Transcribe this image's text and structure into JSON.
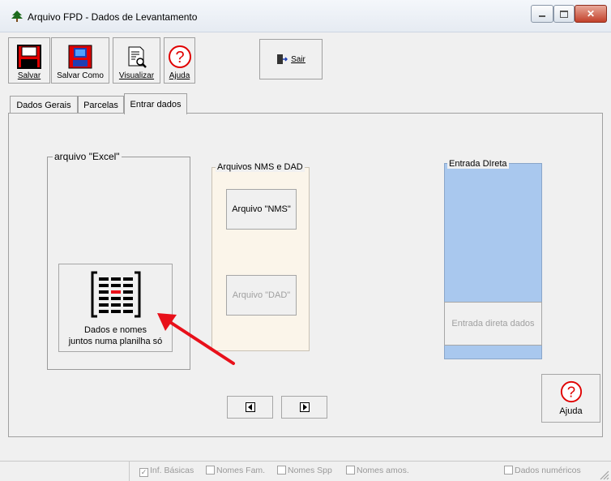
{
  "window": {
    "title": "Arquivo FPD - Dados de Levantamento"
  },
  "toolbar": {
    "salvar": "Salvar",
    "salvar_como": "Salvar Como",
    "visualizar": "Visualizar",
    "ajuda": "Ajuda",
    "sair": "Sair"
  },
  "tabs": [
    {
      "label": "Dados Gerais"
    },
    {
      "label": "Parcelas"
    },
    {
      "label": "Entrar dados",
      "active": true
    }
  ],
  "groups": {
    "excel": {
      "label": "arquivo \"Excel\"",
      "button_line1": "Dados e nomes",
      "button_line2": "juntos numa planilha só"
    },
    "nms_dad": {
      "label": "Arquivos NMS e DAD",
      "nms_button": "Arquivo \"NMS\"",
      "dad_button": "Arquivo \"DAD\""
    },
    "direta": {
      "label": "Entrada DIreta",
      "button": "Entrada direta dados"
    }
  },
  "panel_help": "Ajuda",
  "status": {
    "checks": [
      {
        "label": "Inf. Básicas",
        "checked": true
      },
      {
        "label": "Nomes Fam.",
        "checked": false
      },
      {
        "label": "Nomes Spp",
        "checked": false
      },
      {
        "label": "Nomes amos.",
        "checked": false
      }
    ],
    "numeric": "Dados numéricos"
  },
  "colors": {
    "direct_entry_bg": "#a9c8ee",
    "nms_group_bg": "#fbf5ea",
    "arrow": "#e8101a"
  }
}
